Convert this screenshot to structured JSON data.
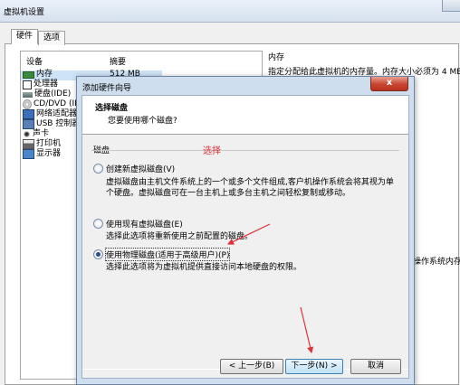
{
  "background_window": {
    "title": "虚拟机设置",
    "tabs": [
      "硬件",
      "选项"
    ],
    "device_list": {
      "col_device": "设备",
      "col_summary": "摘要",
      "items": [
        {
          "label": "内存",
          "summary": "512 MB",
          "icon": "memory-icon"
        },
        {
          "label": "处理器",
          "icon": "processor-icon"
        },
        {
          "label": "硬盘(IDE)",
          "icon": "hard-disk-icon"
        },
        {
          "label": "CD/DVD (ID",
          "icon": "cd-dvd-icon"
        },
        {
          "label": "网络适配器",
          "icon": "network-adapter-icon"
        },
        {
          "label": "USB 控制器",
          "icon": "usb-icon"
        },
        {
          "label": "声卡",
          "icon": "sound-card-icon"
        },
        {
          "label": "打印机",
          "icon": "printer-icon"
        },
        {
          "label": "显示器",
          "icon": "display-icon"
        }
      ]
    },
    "memory_panel": {
      "title": "内存",
      "description": "指定分配给此虚拟机的内存量。内存大小必须为 4 MB",
      "partial_text": "操作系统内存"
    }
  },
  "wizard": {
    "title": "添加硬件向导",
    "close_label": "x",
    "header_title": "选择磁盘",
    "header_subtitle": "您要使用哪个磁盘?",
    "group_label": "磁盘",
    "options": [
      {
        "label": "创建新虚拟磁盘(V)",
        "desc1": "虚拟磁盘由主机文件系统上的一个或多个文件组成,客户机操作系统会将其视为单",
        "desc2": "个硬盘。虚拟磁盘可在一台主机上或多台主机之间轻松复制或移动。",
        "selected": false
      },
      {
        "label": "使用现有虚拟磁盘(E)",
        "desc1": "选择此选项将重新使用之前配置的磁盘。",
        "selected": false
      },
      {
        "label": "使用物理磁盘(适用于高级用户)(P)",
        "desc1": "选择此选项将为虚拟机提供直接访问本地硬盘的权限。",
        "selected": true
      }
    ],
    "annotation": "选择",
    "buttons": {
      "back": "< 上一步(B)",
      "next": "下一步(N) >",
      "cancel": "取消"
    }
  },
  "colors": {
    "annotation": "#e0303a",
    "selection": "#cfe3f7",
    "dialog_frame": "#cfdeef"
  }
}
